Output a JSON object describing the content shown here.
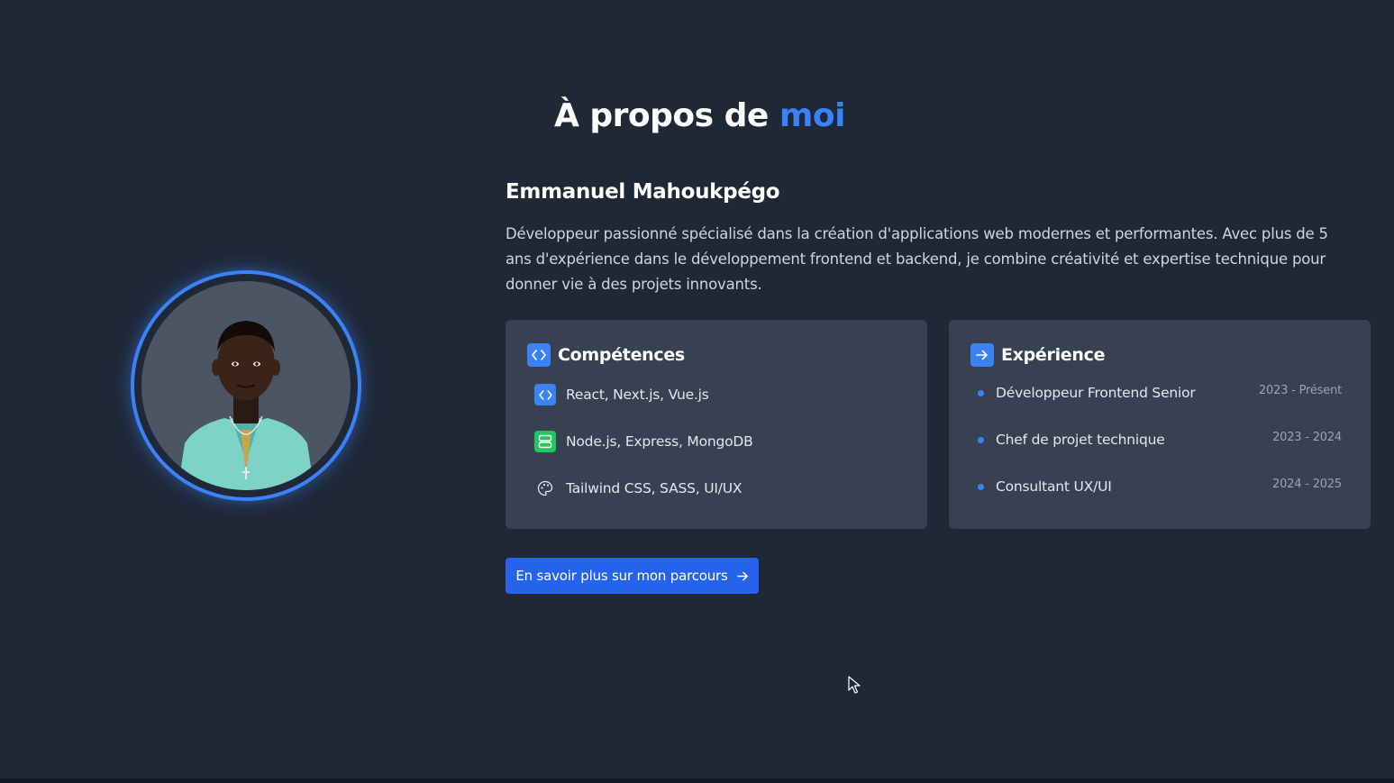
{
  "section": {
    "title_main": "À propos de",
    "title_accent": "moi"
  },
  "profile": {
    "name": "Emmanuel Mahoukpégo",
    "bio": "Développeur passionné spécialisé dans la création d'applications web modernes et performantes. Avec plus de 5 ans d'expérience dans le développement frontend et backend, je combine créativité et expertise technique pour donner vie à des projets innovants."
  },
  "skills": {
    "title": "Compétences",
    "items": [
      {
        "label": "React, Next.js, Vue.js",
        "icon": "code-icon",
        "color": "#3b82f6"
      },
      {
        "label": "Node.js, Express, MongoDB",
        "icon": "server-icon",
        "color": "#22c55e"
      },
      {
        "label": "Tailwind CSS, SASS, UI/UX",
        "icon": "palette-icon",
        "color": "#e5e7eb"
      }
    ]
  },
  "experience": {
    "title": "Expérience",
    "items": [
      {
        "role": "Développeur Frontend Senior",
        "period": "2023 - Présent"
      },
      {
        "role": "Chef de projet technique",
        "period": "2023 - 2024"
      },
      {
        "role": "Consultant UX/UI",
        "period": "2024 - 2025"
      }
    ]
  },
  "cta": {
    "label": "En savoir plus sur mon parcours"
  },
  "colors": {
    "background": "#1f2837",
    "card": "#374151",
    "accent": "#3b82f6",
    "button": "#2563eb"
  }
}
